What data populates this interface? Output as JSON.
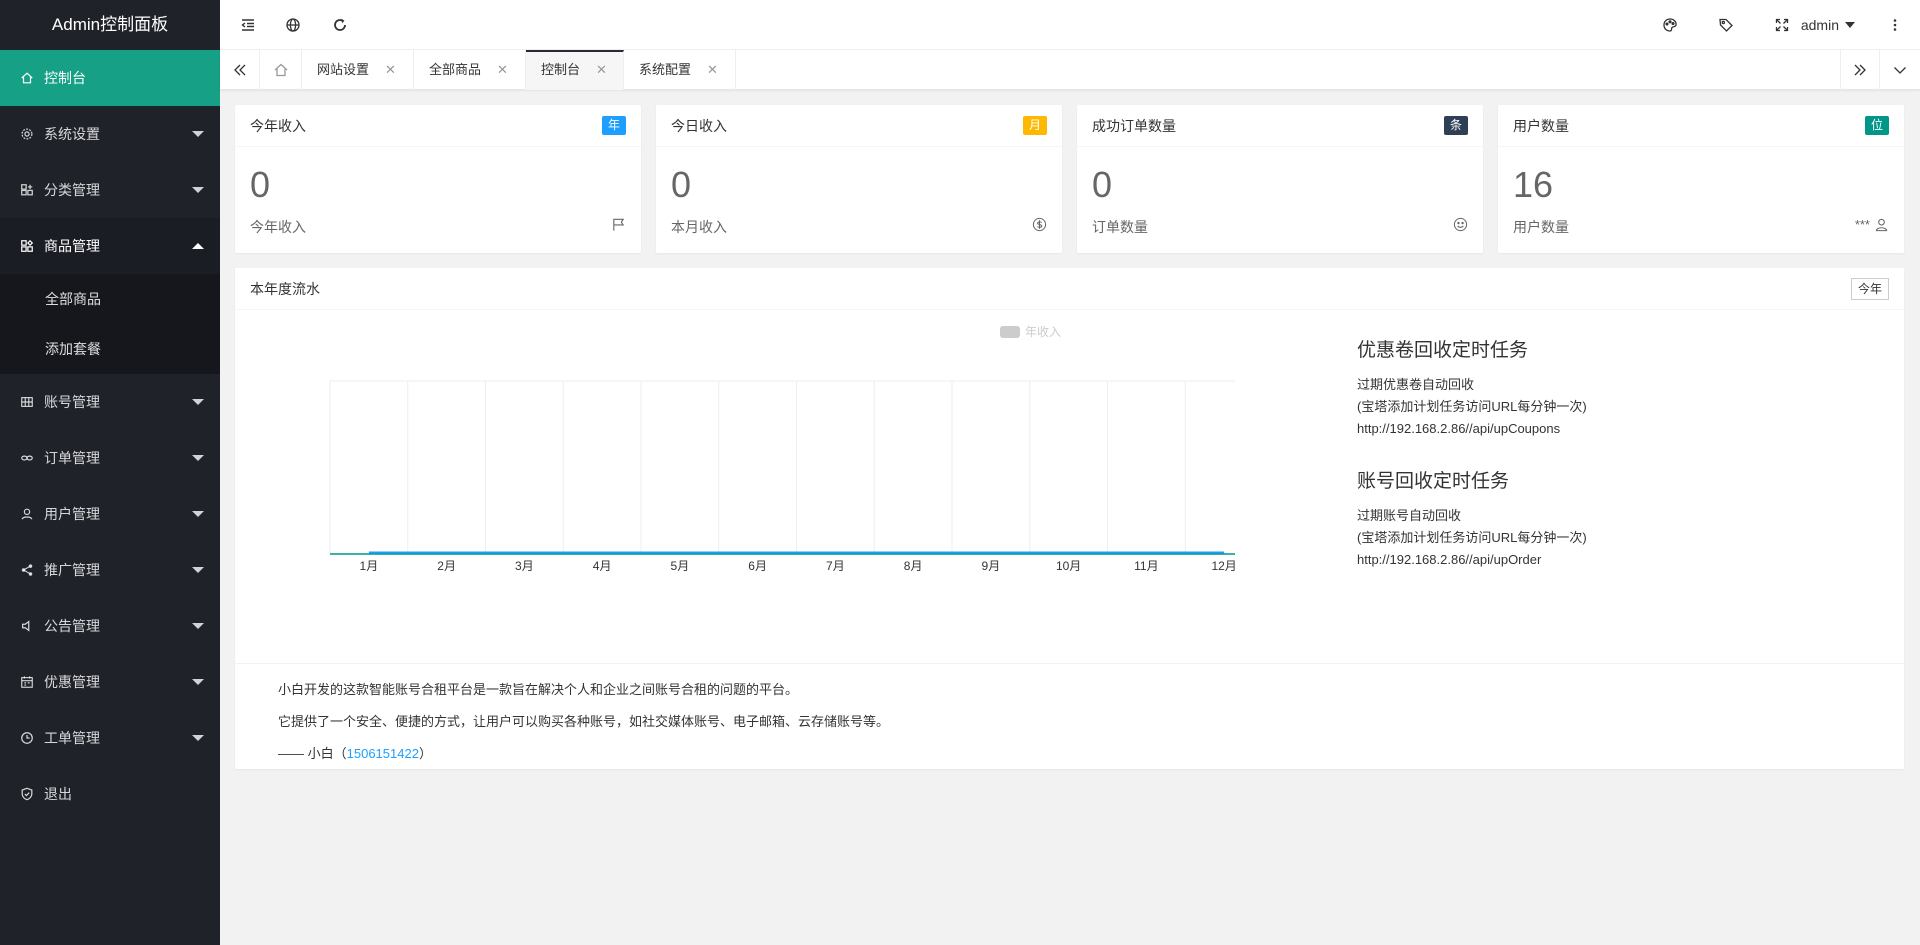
{
  "app": {
    "title": "Admin控制面板"
  },
  "sidebar": {
    "items": [
      {
        "label": "控制台",
        "icon": "home-icon"
      },
      {
        "label": "系统设置",
        "icon": "gear-icon"
      },
      {
        "label": "分类管理",
        "icon": "category-icon"
      },
      {
        "label": "商品管理",
        "icon": "apps-icon",
        "children": [
          "全部商品",
          "添加套餐"
        ]
      },
      {
        "label": "账号管理",
        "icon": "grid-icon"
      },
      {
        "label": "订单管理",
        "icon": "link-icon"
      },
      {
        "label": "用户管理",
        "icon": "user-icon"
      },
      {
        "label": "推广管理",
        "icon": "share-icon"
      },
      {
        "label": "公告管理",
        "icon": "speaker-icon"
      },
      {
        "label": "优惠管理",
        "icon": "calendar-icon"
      },
      {
        "label": "工单管理",
        "icon": "clock-icon"
      },
      {
        "label": "退出",
        "icon": "shield-check-icon"
      }
    ]
  },
  "header": {
    "user": "admin"
  },
  "tabs": {
    "items": [
      {
        "label": "网站设置"
      },
      {
        "label": "全部商品"
      },
      {
        "label": "控制台"
      },
      {
        "label": "系统配置"
      }
    ],
    "active_index": 2,
    "close_glyph": "✕"
  },
  "stats": [
    {
      "title": "今年收入",
      "badge": "年",
      "badge_color": "#1e9fff",
      "value": "0",
      "label": "今年收入",
      "icon": "flag-icon"
    },
    {
      "title": "今日收入",
      "badge": "月",
      "badge_color": "#ffb800",
      "value": "0",
      "label": "本月收入",
      "icon": "dollar-icon"
    },
    {
      "title": "成功订单数量",
      "badge": "条",
      "badge_color": "#2f4056",
      "value": "0",
      "label": "订单数量",
      "icon": "smile-icon"
    },
    {
      "title": "用户数量",
      "badge": "位",
      "badge_color": "#009688",
      "value": "16",
      "label": "用户数量",
      "icon": "user-icon",
      "extra": "***"
    }
  ],
  "panel": {
    "title": "本年度流水",
    "button": "今年",
    "tasks": [
      {
        "title": "优惠卷回收定时任务",
        "lines": [
          "过期优惠卷自动回收",
          "(宝塔添加计划任务访问URL每分钟一次)",
          "http://192.168.2.86//api/upCoupons"
        ]
      },
      {
        "title": "账号回收定时任务",
        "lines": [
          "过期账号自动回收",
          "(宝塔添加计划任务访问URL每分钟一次)",
          "http://192.168.2.86//api/upOrder"
        ]
      }
    ],
    "about": {
      "line1": "小白开发的这款智能账号合租平台是一款旨在解决个人和企业之间账号合租的问题的平台。",
      "line2": "它提供了一个安全、便捷的方式，让用户可以购买各种账号，如社交媒体账号、电子邮箱、云存储账号等。",
      "signature_prefix": "—— 小白（",
      "signature_link": "1506151422",
      "signature_suffix": "）"
    }
  },
  "chart_data": {
    "type": "line",
    "categories": [
      "1月",
      "2月",
      "3月",
      "4月",
      "5月",
      "6月",
      "7月",
      "8月",
      "9月",
      "10月",
      "11月",
      "12月"
    ],
    "series": [
      {
        "name": "年收入",
        "values": [
          0,
          0,
          0,
          0,
          0,
          0,
          0,
          0,
          0,
          0,
          0,
          0
        ]
      }
    ],
    "ylim": [
      0,
      1
    ],
    "grid": true,
    "legend": "top",
    "series_color": "#1e9fff"
  }
}
